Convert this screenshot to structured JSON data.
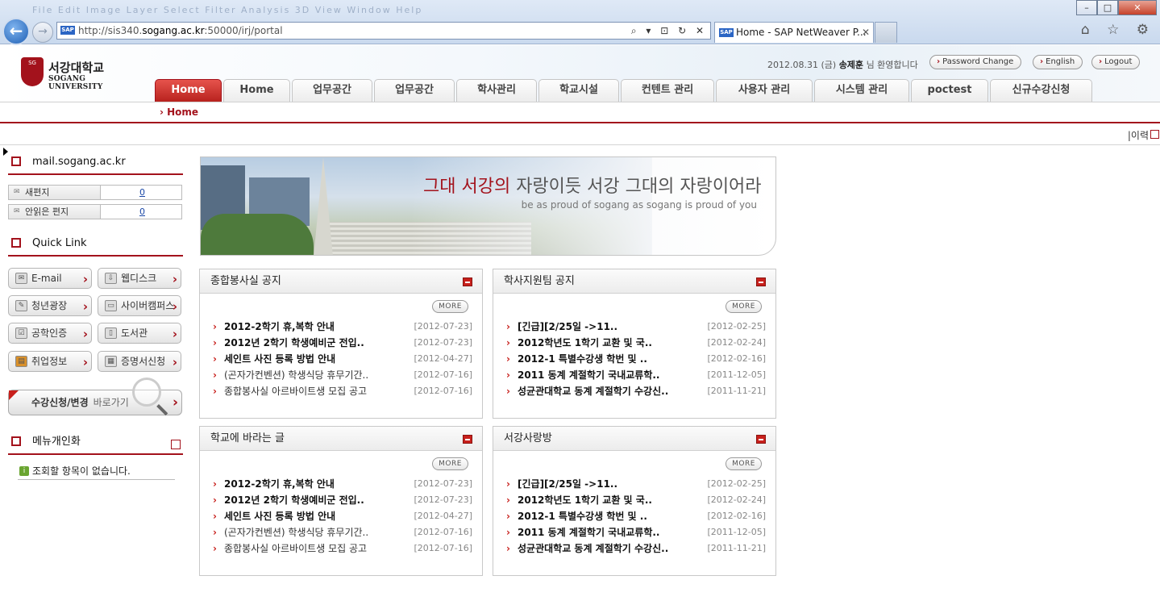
{
  "browser": {
    "menu_ghost": "File   Edit   Image   Layer   Select   Filter   Analysis   3D   View   Window   Help",
    "address_prefix": "http://sis340.",
    "address_host": "sogang.ac.kr",
    "address_suffix": ":50000/irj/portal",
    "address_tools": "⌕ ▾ ⊡ ↻ ✕",
    "tab_title": "Home - SAP NetWeaver P...",
    "tab_close": "✕",
    "sap_icon": "SAP",
    "right_icons": "⌂ ☆ ⚙",
    "window_min": "–",
    "window_max": "□",
    "window_close": "✕",
    "back": "←",
    "forward": "→"
  },
  "header": {
    "logo_kor": "서강대학교",
    "logo_eng": "SOGANG UNIVERSITY",
    "logo_emblem": "SG",
    "date": "2012.08.31 (금)",
    "user_name": "송제훈",
    "greeting": "님 환영합니다",
    "buttons": {
      "password_change": "Password Change",
      "english": "English",
      "logout": "Logout"
    },
    "chev": "›"
  },
  "gnb": {
    "tabs": [
      "Home",
      "Home",
      "업무공간",
      "업무공간",
      "학사관리",
      "학교시설",
      "컨텐트 관리",
      "사용자 관리",
      "시스템 관리",
      "poctest",
      "신규수강신청"
    ]
  },
  "subnav": {
    "breadcrumb": "› Home"
  },
  "history": {
    "label": "|이력"
  },
  "left": {
    "mail_title": "mail.sogang.ac.kr",
    "mail_rows": [
      {
        "label": "새편지",
        "count": "0"
      },
      {
        "label": "안읽은 편지",
        "count": "0"
      }
    ],
    "quicklink_title": "Quick Link",
    "quick_links": [
      "E-mail",
      "웹디스크",
      "청년광장",
      "사이버캠퍼스",
      "공학인증",
      "도서관",
      "취업정보",
      "증명서신청"
    ],
    "arrow": "›",
    "register_label": "수강신청/변경",
    "register_go": "바로가기",
    "personal_title": "메뉴개인화",
    "empty_message": "조회할 항목이 없습니다.",
    "info_icon": "i"
  },
  "banner": {
    "slogan_em": "그대 서강의",
    "slogan_rest": " 자랑이듯 서강 그대의 자랑이어라",
    "subtitle": "be as proud of sogang as sogang is proud of you"
  },
  "boards": [
    {
      "title": "종합봉사실 공지",
      "more": "MORE",
      "items": [
        {
          "title": "2012-2학기 휴,복학 안내",
          "date": "[2012-07-23]",
          "bold": true
        },
        {
          "title": "2012년 2학기 학생예비군 전입..",
          "date": "[2012-07-23]",
          "bold": true
        },
        {
          "title": "세인트 사진 등록 방법 안내",
          "date": "[2012-04-27]",
          "bold": true
        },
        {
          "title": "(곤자가컨벤션) 학생식당 휴무기간..",
          "date": "[2012-07-16]",
          "bold": false
        },
        {
          "title": "종합봉사실 아르바이트생 모집 공고",
          "date": "[2012-07-16]",
          "bold": false
        }
      ]
    },
    {
      "title": "학사지원팀 공지",
      "more": "MORE",
      "items": [
        {
          "title": "[긴급][2/25일 ->11..",
          "date": "[2012-02-25]",
          "bold": true
        },
        {
          "title": "2012학년도 1학기 교환 및 국..",
          "date": "[2012-02-24]",
          "bold": true
        },
        {
          "title": "2012-1 특별수강생 학번 및 ..",
          "date": "[2012-02-16]",
          "bold": true
        },
        {
          "title": "2011 동계 계절학기 국내교류학..",
          "date": "[2011-12-05]",
          "bold": true
        },
        {
          "title": "성균관대학교 동계 계절학기 수강신..",
          "date": "[2011-11-21]",
          "bold": true
        }
      ]
    },
    {
      "title": "학교에 바라는 글",
      "more": "MORE",
      "items": [
        {
          "title": "2012-2학기 휴,복학 안내",
          "date": "[2012-07-23]",
          "bold": true
        },
        {
          "title": "2012년 2학기 학생예비군 전입..",
          "date": "[2012-07-23]",
          "bold": true
        },
        {
          "title": "세인트 사진 등록 방법 안내",
          "date": "[2012-04-27]",
          "bold": true
        },
        {
          "title": "(곤자가컨벤션) 학생식당 휴무기간..",
          "date": "[2012-07-16]",
          "bold": false
        },
        {
          "title": "종합봉사실 아르바이트생 모집 공고",
          "date": "[2012-07-16]",
          "bold": false
        }
      ]
    },
    {
      "title": "서강사랑방",
      "more": "MORE",
      "items": [
        {
          "title": "[긴급][2/25일 ->11..",
          "date": "[2012-02-25]",
          "bold": true
        },
        {
          "title": "2012학년도 1학기 교환 및 국..",
          "date": "[2012-02-24]",
          "bold": true
        },
        {
          "title": "2012-1 특별수강생 학번 및 ..",
          "date": "[2012-02-16]",
          "bold": true
        },
        {
          "title": "2011 동계 계절학기 국내교류학..",
          "date": "[2011-12-05]",
          "bold": true
        },
        {
          "title": "성균관대학교 동계 계절학기 수강신..",
          "date": "[2011-11-21]",
          "bold": true
        }
      ]
    }
  ],
  "colors": {
    "brand": "#a3121c",
    "accent_red": "#c8201c",
    "link_blue": "#1a47a6"
  }
}
